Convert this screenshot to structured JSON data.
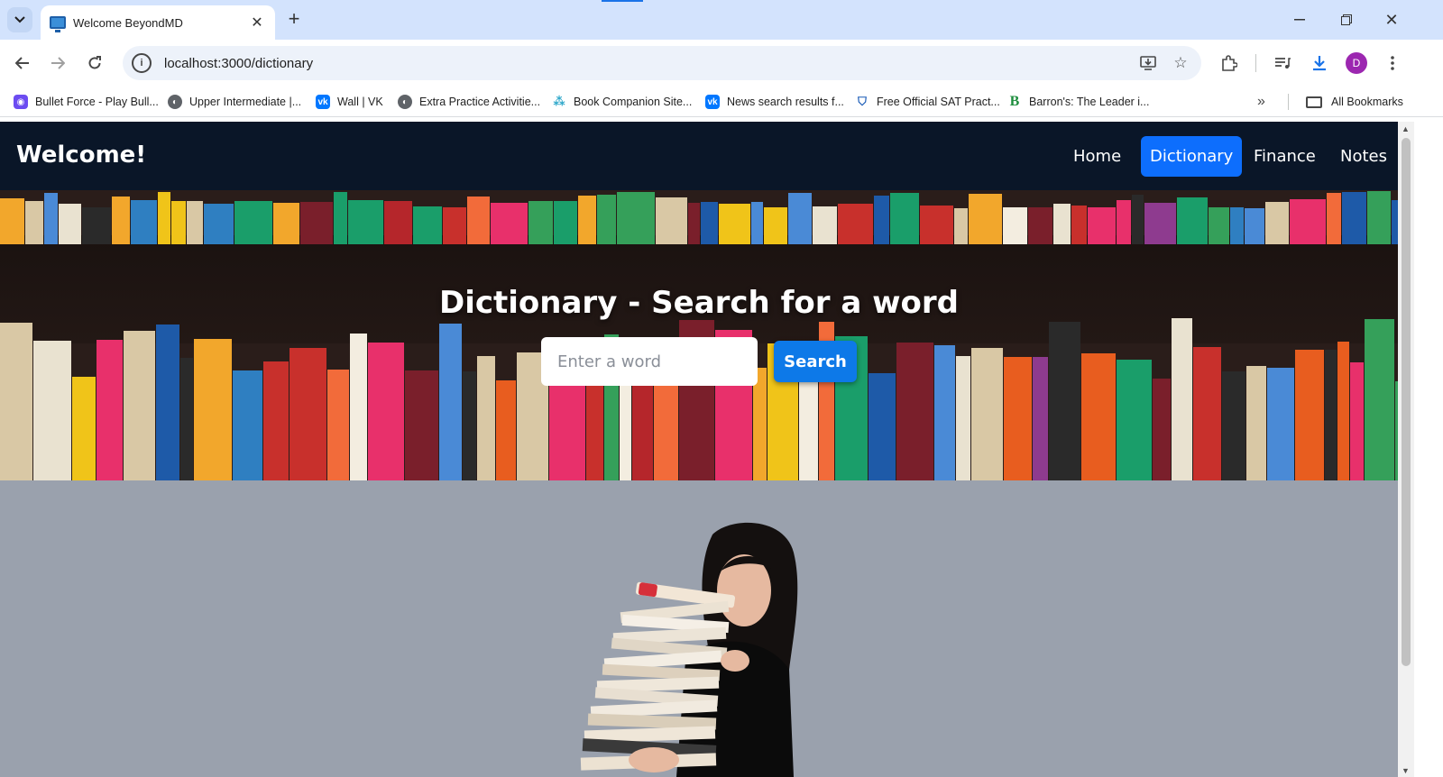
{
  "browser": {
    "tab_title": "Welcome BeyondMD",
    "url": "localhost:3000/dictionary",
    "profile_initial": "D",
    "bookmarks": [
      {
        "label": "Bullet Force - Play Bull...",
        "color": "#6c4cf1"
      },
      {
        "label": "Upper Intermediate |...",
        "color": "#5f6368"
      },
      {
        "label": "Wall | VK",
        "color": "#0077ff"
      },
      {
        "label": "Extra Practice Activitie...",
        "color": "#5f6368"
      },
      {
        "label": "Book Companion Site...",
        "color": "#2aa6c9"
      },
      {
        "label": "News search results f...",
        "color": "#0077ff"
      },
      {
        "label": "Free Official SAT Pract...",
        "color": "#1c5db8"
      },
      {
        "label": "Barron's: The Leader i...",
        "color": "#1e8e3e"
      }
    ],
    "all_bookmarks_label": "All Bookmarks"
  },
  "app": {
    "brand": "Welcome!",
    "nav": [
      {
        "label": "Home",
        "active": false
      },
      {
        "label": "Dictionary",
        "active": true
      },
      {
        "label": "Finance",
        "active": false
      },
      {
        "label": "Notes",
        "active": false
      }
    ]
  },
  "hero": {
    "title": "Dictionary - Search for a word",
    "input_placeholder": "Enter a word",
    "search_label": "Search"
  },
  "colors": {
    "nav_bg": "#0a1628",
    "accent": "#0d6efd",
    "page_bg": "#9aa1ad"
  }
}
